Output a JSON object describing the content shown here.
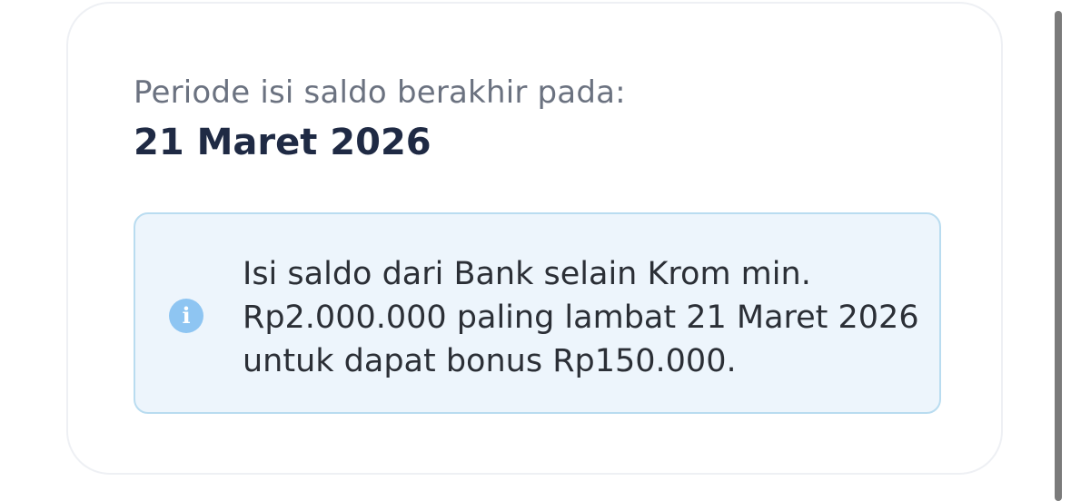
{
  "period": {
    "label": "Periode isi saldo berakhir pada:",
    "end_date": "21 Maret 2026"
  },
  "info": {
    "icon": "info-circle-icon",
    "lines": [
      "Isi saldo dari Bank selain Krom min.",
      "Rp2.000.000 paling lambat 21 Maret 2026",
      "untuk dapat bonus Rp150.000."
    ]
  },
  "colors": {
    "info_background": "#edf5fc",
    "info_border": "#b9dcf0",
    "info_icon": "#8ec5f2",
    "date_text": "#1f2a44"
  }
}
